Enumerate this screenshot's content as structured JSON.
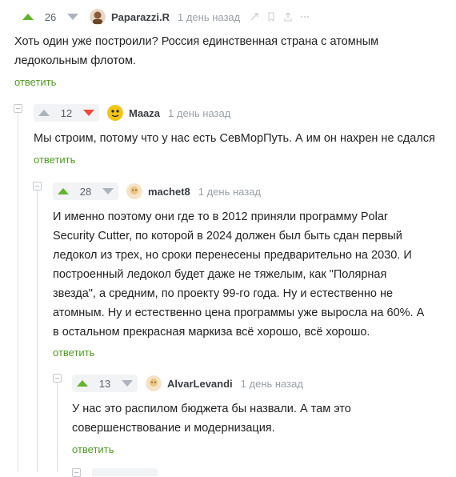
{
  "comments": [
    {
      "rating": "26",
      "author": "Paparazzi.R",
      "time": "1 день назад",
      "text": "Хоть один уже построили? Россия единственная страна с атомным ледокольным флотом.",
      "reply_label": "ответить"
    },
    {
      "rating": "12",
      "author": "Maaza",
      "time": "1 день назад",
      "text": "Мы строим, потому что у нас есть СевМорПуть. А им он нахрен не сдался",
      "reply_label": "ответить"
    },
    {
      "rating": "28",
      "author": "machet8",
      "time": "1 день назад",
      "text": "И именно поэтому они где то в 2012 приняли программу Polar Security Cutter, по которой в 2024 должен был быть сдан первый ледокол из трех, но сроки перенесены предварительно на 2030. И построенный ледокол будет даже не тяжелым, как \"Полярная звезда\", а средним, по проекту 99-го года. Ну и естественно не атомным. Ну и естественно цена программы уже выросла на 60%. А в остальном прекрасная маркиза всё хорошо, всё хорошо.",
      "reply_label": "ответить"
    },
    {
      "rating": "13",
      "author": "AlvarLevandi",
      "time": "1 день назад",
      "text": "У нас это распилом бюджета бы назвали. А там это совершенствование и модернизация.",
      "reply_label": "ответить"
    }
  ],
  "colors": {
    "upvote_active": "#61b52d",
    "downvote_active": "#ef4a3a",
    "reply_link": "#4e9a22"
  },
  "icons": [
    "arrow-up-icon",
    "arrow-down-icon",
    "link-icon",
    "bookmark-icon",
    "share-icon",
    "more-icon",
    "collapse-icon"
  ]
}
